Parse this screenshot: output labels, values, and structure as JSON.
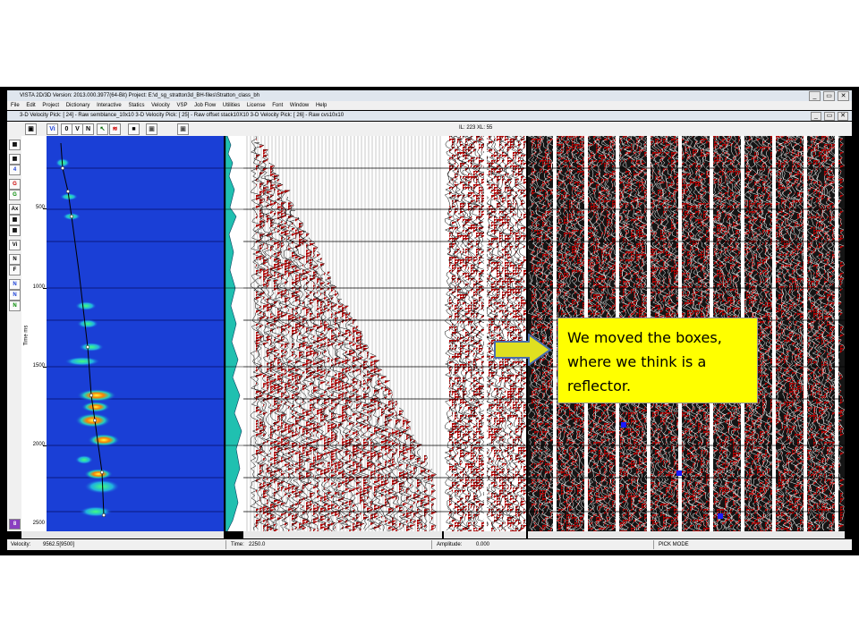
{
  "window": {
    "title": "VISTA 2D/3D Version: 2013.000.3977(64-Bit) Project: E:\\d_sg_stratton3d_BH-files\\Stratton_class_bh",
    "controls": [
      "_",
      "▭",
      "✕"
    ]
  },
  "menu": [
    "File",
    "Edit",
    "Project",
    "Dictionary",
    "Interactive",
    "Statics",
    "Velocity",
    "VSP",
    "Job Flow",
    "Utilities",
    "License",
    "Font",
    "Window",
    "Help"
  ],
  "subwindow": {
    "title": "3-D Velocity Pick: [ 24] - Raw semblance_10x10 3-D Velocity Pick: [ 25] - Raw offset stack10X10 3-D Velocity Pick: [ 26] - Raw cvs10x10",
    "controls": [
      "_",
      "▭",
      "✕"
    ]
  },
  "toolbar": {
    "buttons": [
      "▣",
      "Vi",
      "0",
      "V",
      "N",
      "↖",
      "≋",
      "■",
      "▣",
      "▣"
    ],
    "il_xl": "IL: 223 XL: 55"
  },
  "left_tools": [
    "▦",
    "▦",
    "4",
    "G",
    "G",
    "Ax",
    "▦",
    "▦",
    "Vi",
    "N",
    "F",
    "N",
    "N",
    "N",
    "8"
  ],
  "time_axis": {
    "label": "Time ms",
    "ticks": [
      "500",
      "1000",
      "1500",
      "2000",
      "2500"
    ]
  },
  "status": {
    "velocity_label": "Velocity:",
    "velocity_value": "9562.5[9500]",
    "time_label": "Time:",
    "time_value": "2250.0",
    "amplitude_label": "Amplitude:",
    "amplitude_value": "0.000",
    "mode": "PICK MODE"
  },
  "callout": {
    "text": "We moved the boxes, where we think is a reflector."
  },
  "colors": {
    "semblance_bg": "#1a3fd6",
    "wiggle_fill": "#b00000",
    "callout_bg": "#ffff00",
    "arrow": "#e0e020",
    "pick_marker": "#1a1aff"
  }
}
